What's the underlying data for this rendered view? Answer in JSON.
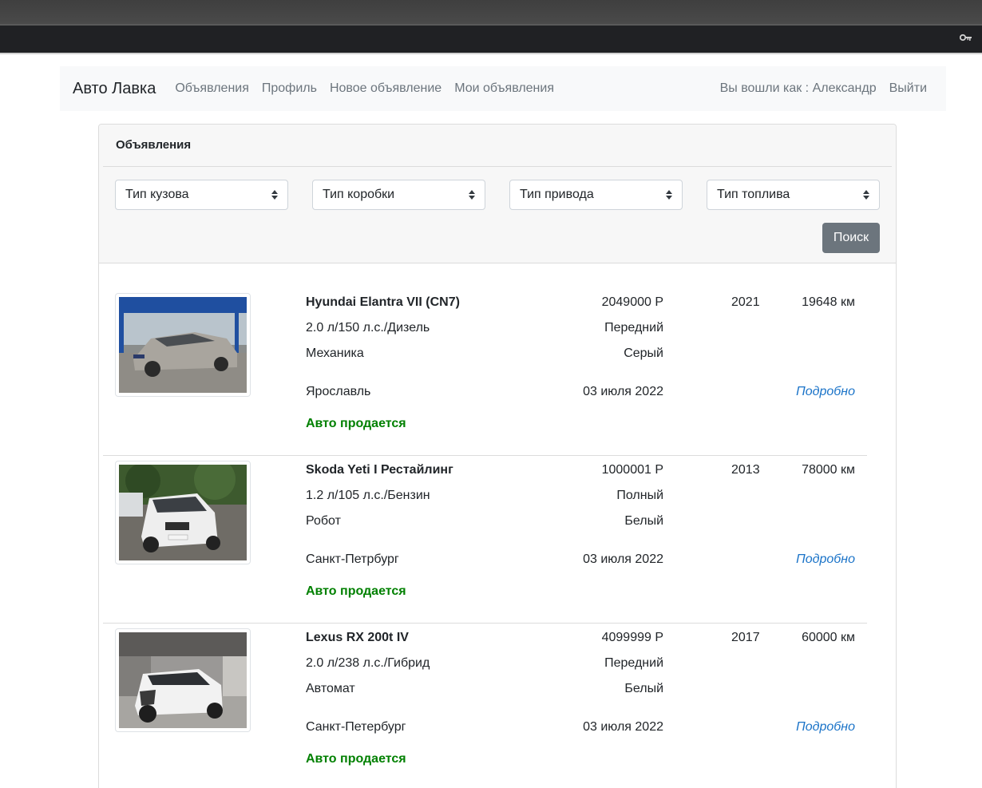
{
  "navbar": {
    "brand": "Авто Лавка",
    "links": [
      "Объявления",
      "Профиль",
      "Новое объявление",
      "Мои объявления"
    ],
    "logged_in_text": "Вы вошли как : Александр",
    "logout": "Выйти"
  },
  "card": {
    "title": "Объявления",
    "filters": [
      "Тип кузова",
      "Тип коробки",
      "Тип привода",
      "Тип топлива"
    ],
    "search_button": "Поиск"
  },
  "listings": [
    {
      "title": "Hyundai Elantra VII (CN7)",
      "engine": "2.0 л/150 л.с./Дизель",
      "transmission": "Механика",
      "city": "Ярославль",
      "status": "Авто продается",
      "price": "2049000 Р",
      "drive": "Передний",
      "color": "Серый",
      "date": "03 июля 2022",
      "year": "2021",
      "mileage": "19648 км",
      "more": "Подробно"
    },
    {
      "title": "Skoda Yeti I Рестайлинг",
      "engine": "1.2 л/105 л.с./Бензин",
      "transmission": "Робот",
      "city": "Санкт-Петрбург",
      "status": "Авто продается",
      "price": "1000001 Р",
      "drive": "Полный",
      "color": "Белый",
      "date": "03 июля 2022",
      "year": "2013",
      "mileage": "78000 км",
      "more": "Подробно"
    },
    {
      "title": "Lexus RX 200t IV",
      "engine": "2.0 л/238 л.с./Гибрид",
      "transmission": "Автомат",
      "city": "Санкт-Петербург",
      "status": "Авто продается",
      "price": "4099999 Р",
      "drive": "Передний",
      "color": "Белый",
      "date": "03 июля 2022",
      "year": "2017",
      "mileage": "60000 км",
      "more": "Подробно"
    }
  ],
  "colors": {
    "status_green": "#008000",
    "link_blue": "#1a73c8",
    "button_gray": "#6c757d"
  },
  "icons": [
    "key-icon",
    "select-arrows-icon"
  ]
}
